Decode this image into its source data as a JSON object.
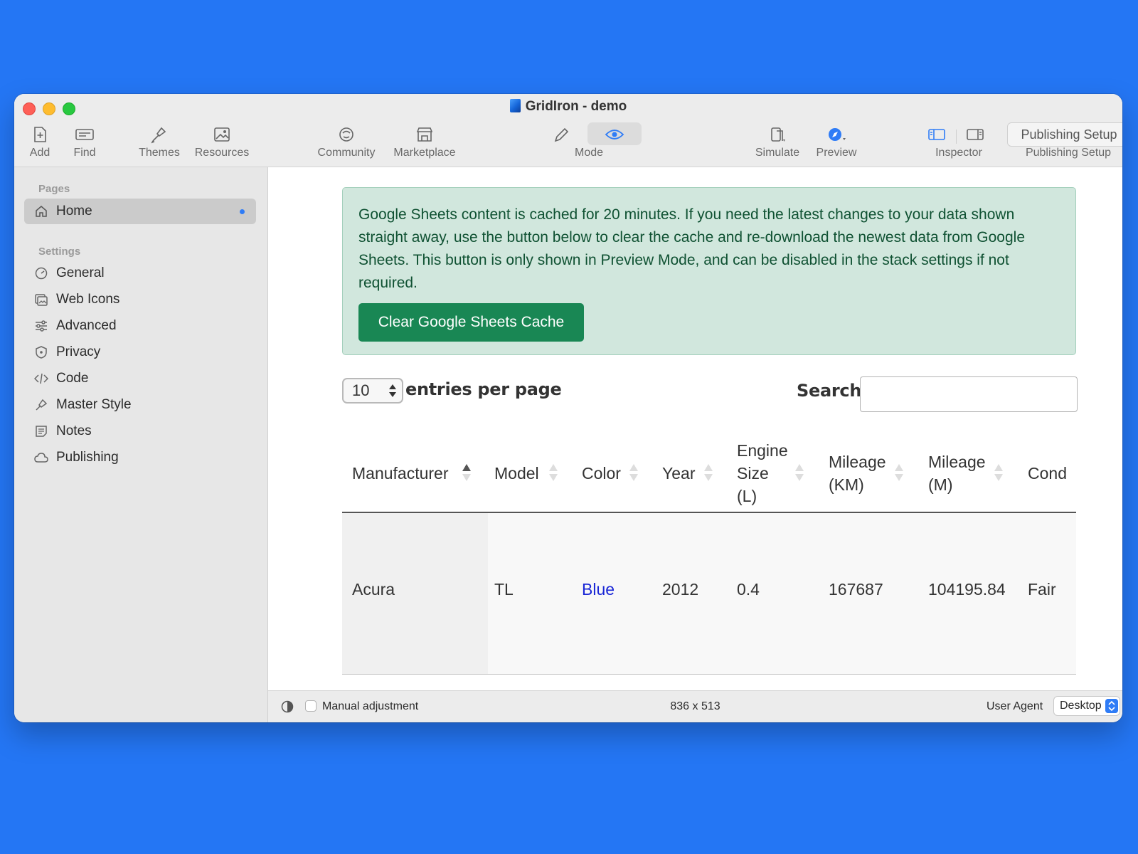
{
  "window": {
    "title": "GridIron - demo"
  },
  "toolbar": {
    "add": "Add",
    "find": "Find",
    "themes": "Themes",
    "resources": "Resources",
    "community": "Community",
    "marketplace": "Marketplace",
    "mode": "Mode",
    "simulate": "Simulate",
    "preview": "Preview",
    "inspector": "Inspector",
    "publishing_button": "Publishing Setup",
    "publishing_label": "Publishing Setup"
  },
  "sidebar": {
    "pages_heading": "Pages",
    "pages": [
      {
        "label": "Home",
        "icon": "home-icon",
        "active": true
      }
    ],
    "settings_heading": "Settings",
    "settings": [
      {
        "label": "General",
        "icon": "gauge-icon"
      },
      {
        "label": "Web Icons",
        "icon": "images-icon"
      },
      {
        "label": "Advanced",
        "icon": "sliders-icon"
      },
      {
        "label": "Privacy",
        "icon": "shield-icon"
      },
      {
        "label": "Code",
        "icon": "code-icon"
      },
      {
        "label": "Master Style",
        "icon": "brush-icon"
      },
      {
        "label": "Notes",
        "icon": "notes-icon"
      },
      {
        "label": "Publishing",
        "icon": "cloud-icon"
      }
    ]
  },
  "content": {
    "alert_text": "Google Sheets content is cached for 20 minutes. If you need the latest changes to your data shown straight away, use the button below to clear the cache and re-download the newest data from Google Sheets. This button is only shown in Preview Mode, and can be disabled in the stack settings if not required.",
    "clear_button": "Clear Google Sheets Cache",
    "page_length": "10",
    "page_length_label": "entries per page",
    "search_label": "Search:",
    "search_value": "",
    "table": {
      "columns": [
        "Manufacturer",
        "Model",
        "Color",
        "Year",
        "Engine Size (L)",
        "Mileage (KM)",
        "Mileage (M)",
        "Cond"
      ],
      "header_lines": {
        "engine": [
          "Engine",
          "Size",
          "(L)"
        ],
        "mileage_km": [
          "Mileage",
          "(KM)"
        ],
        "mileage_m": [
          "Mileage",
          "(M)"
        ]
      },
      "rows": [
        [
          "Acura",
          "TL",
          "Blue",
          "2012",
          "0.4",
          "167687",
          "104195.84",
          "Fair"
        ]
      ]
    }
  },
  "statusbar": {
    "manual_adjustment": "Manual adjustment",
    "manual_checked": false,
    "viewport_size": "836 x 513",
    "user_agent_label": "User Agent",
    "user_agent_value": "Desktop"
  },
  "colors": {
    "desktop": "#2476f4",
    "alert_bg": "#d1e7dd",
    "alert_text": "#0f5132",
    "button_green": "#198754",
    "link_blue": "#1a27d6",
    "accent": "#2f7cf6"
  }
}
